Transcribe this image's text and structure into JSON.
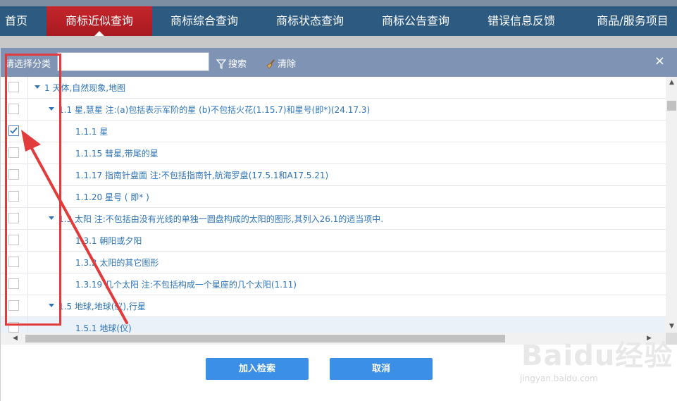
{
  "nav": {
    "items": [
      {
        "label": "首页",
        "active": false
      },
      {
        "label": "商标近似查询",
        "active": true
      },
      {
        "label": "商标综合查询",
        "active": false
      },
      {
        "label": "商标状态查询",
        "active": false
      },
      {
        "label": "商标公告查询",
        "active": false
      },
      {
        "label": "错误信息反馈",
        "active": false
      },
      {
        "label": "商品/服务项目",
        "active": false
      }
    ]
  },
  "toolbar": {
    "label": "请选择分类",
    "search_value": "",
    "search_label": "搜索",
    "clear_label": "清除",
    "close_glyph": "×"
  },
  "tree": {
    "rows": [
      {
        "text": "1 天体,自然现象,地图",
        "level": 0,
        "expandable": true,
        "checked": false
      },
      {
        "text": "1.1 星,慧星 注:(a)包括表示军阶的星 (b)不包括火花(1.15.7)和星号(即*)(24.17.3)",
        "level": 1,
        "expandable": true,
        "checked": false
      },
      {
        "text": "1.1.1 星",
        "level": 2,
        "expandable": false,
        "checked": true
      },
      {
        "text": "1.1.15 彗星,带尾的星",
        "level": 2,
        "expandable": false,
        "checked": false
      },
      {
        "text": "1.1.17 指南针盘面 注:不包括指南针,航海罗盘(17.5.1和A17.5.21)",
        "level": 2,
        "expandable": false,
        "checked": false
      },
      {
        "text": "1.1.20 星号 ( 即* )",
        "level": 2,
        "expandable": false,
        "checked": false
      },
      {
        "text": "1.3 太阳 注:不包括由没有光线的单独一圆盘构成的太阳的图形,其列入26.1的适当项中.",
        "level": 1,
        "expandable": true,
        "checked": false
      },
      {
        "text": "1.3.1 朝阳或夕阳",
        "level": 2,
        "expandable": false,
        "checked": false
      },
      {
        "text": "1.3.2 太阳的其它图形",
        "level": 2,
        "expandable": false,
        "checked": false
      },
      {
        "text": "1.3.19 几个太阳 注:不包括构成一个星座的几个太阳(1.11)",
        "level": 2,
        "expandable": false,
        "checked": false
      },
      {
        "text": "1.5 地球,地球(仪),行星",
        "level": 1,
        "expandable": true,
        "checked": false
      },
      {
        "text": "1.5.1 地球(仪)",
        "level": 2,
        "expandable": false,
        "checked": false
      }
    ]
  },
  "buttons": {
    "add_label": "加入检索",
    "cancel_label": "取消"
  },
  "watermark": {
    "brand": "Baidu经验",
    "url": "jingyan.baidu.com"
  },
  "colors": {
    "nav_bg": "#2d5a80",
    "nav_active": "#c4262c",
    "toolbar_bg": "#7f94b5",
    "link_blue": "#2d74b8",
    "button_blue": "#3b8fe6",
    "annotation_red": "#e23b3b"
  }
}
